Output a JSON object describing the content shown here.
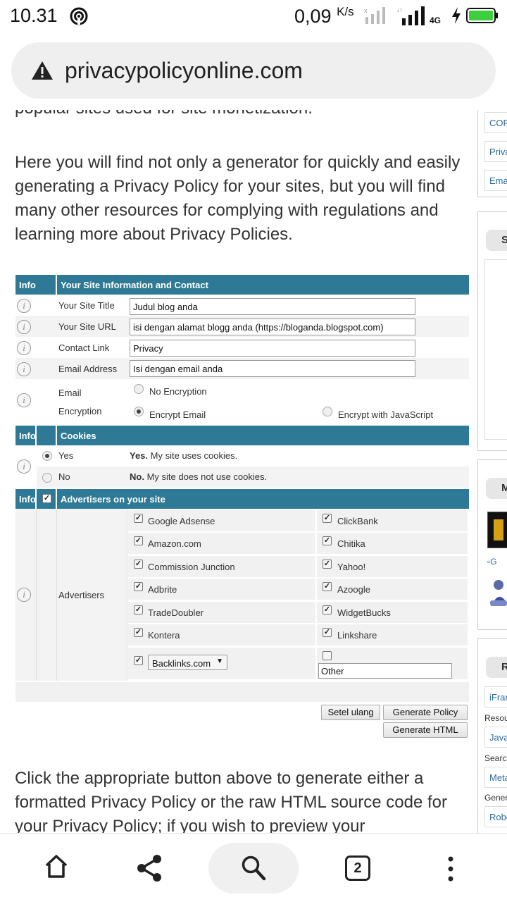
{
  "status": {
    "time": "10.31",
    "speed": "0,09",
    "speed_unit": "K/s",
    "network": "4G"
  },
  "browser": {
    "url": "privacypolicyonline.com",
    "tab_count": "2"
  },
  "article": {
    "cut_line": "popular sites used for site monetization.",
    "intro": "Here you will find not only a generator for quickly and easily generating a Privacy Policy for your sites, but you will find many other resources for complying with regulations and learning more about Privacy Policies.",
    "outro": "Click the appropriate button above to generate either a formatted Privacy Policy or the raw HTML source code for your Privacy Policy; if you wish to preview your"
  },
  "sidebar": {
    "links_top": [
      "COP",
      "Priva",
      "Ema"
    ],
    "head1": "S",
    "head2": "M",
    "img_alt": "G",
    "head3": "R",
    "link_iframe": "iFran",
    "label_resources": "Resou",
    "link_java": "Java",
    "label_search": "Searc",
    "link_meta": "Meta",
    "label_general": "Gener",
    "link_robots": "Robo"
  },
  "form": {
    "info_col": "Info",
    "site_section": "Your Site Information and Contact",
    "site_title_label": "Your Site Title",
    "site_title_value": "Judul blog anda",
    "site_url_label": "Your Site URL",
    "site_url_value": "isi dengan alamat blogg anda (https://bloganda.blogspot.com)",
    "contact_label": "Contact Link",
    "contact_value": "Privacy",
    "email_label": "Email Address",
    "email_value": "Isi dengan email anda",
    "enc_label_1": "Email",
    "enc_label_2": "Encryption",
    "enc_none": "No Encryption",
    "enc_email": "Encrypt Email",
    "enc_js": "Encrypt with JavaScript",
    "cookies_section": "Cookies",
    "yes_label": "Yes",
    "yes_bold": "Yes.",
    "yes_desc": "My site uses cookies.",
    "no_label": "No",
    "no_bold": "No.",
    "no_desc": "My site does not use cookies.",
    "adv_section": "Advertisers on your site",
    "adv_label": "Advertisers",
    "advertisers_left": [
      "Google Adsense",
      "Amazon.com",
      "Commission Junction",
      "Adbrite",
      "TradeDoubler",
      "Kontera"
    ],
    "advertisers_right": [
      "ClickBank",
      "Chitika",
      "Yahoo!",
      "Azoogle",
      "WidgetBucks",
      "Linkshare"
    ],
    "backlinks_select": "Backlinks.com",
    "other_value": "Other",
    "reset_button": "Setel ulang",
    "policy_button": "Generate Policy",
    "html_button": "Generate HTML"
  }
}
